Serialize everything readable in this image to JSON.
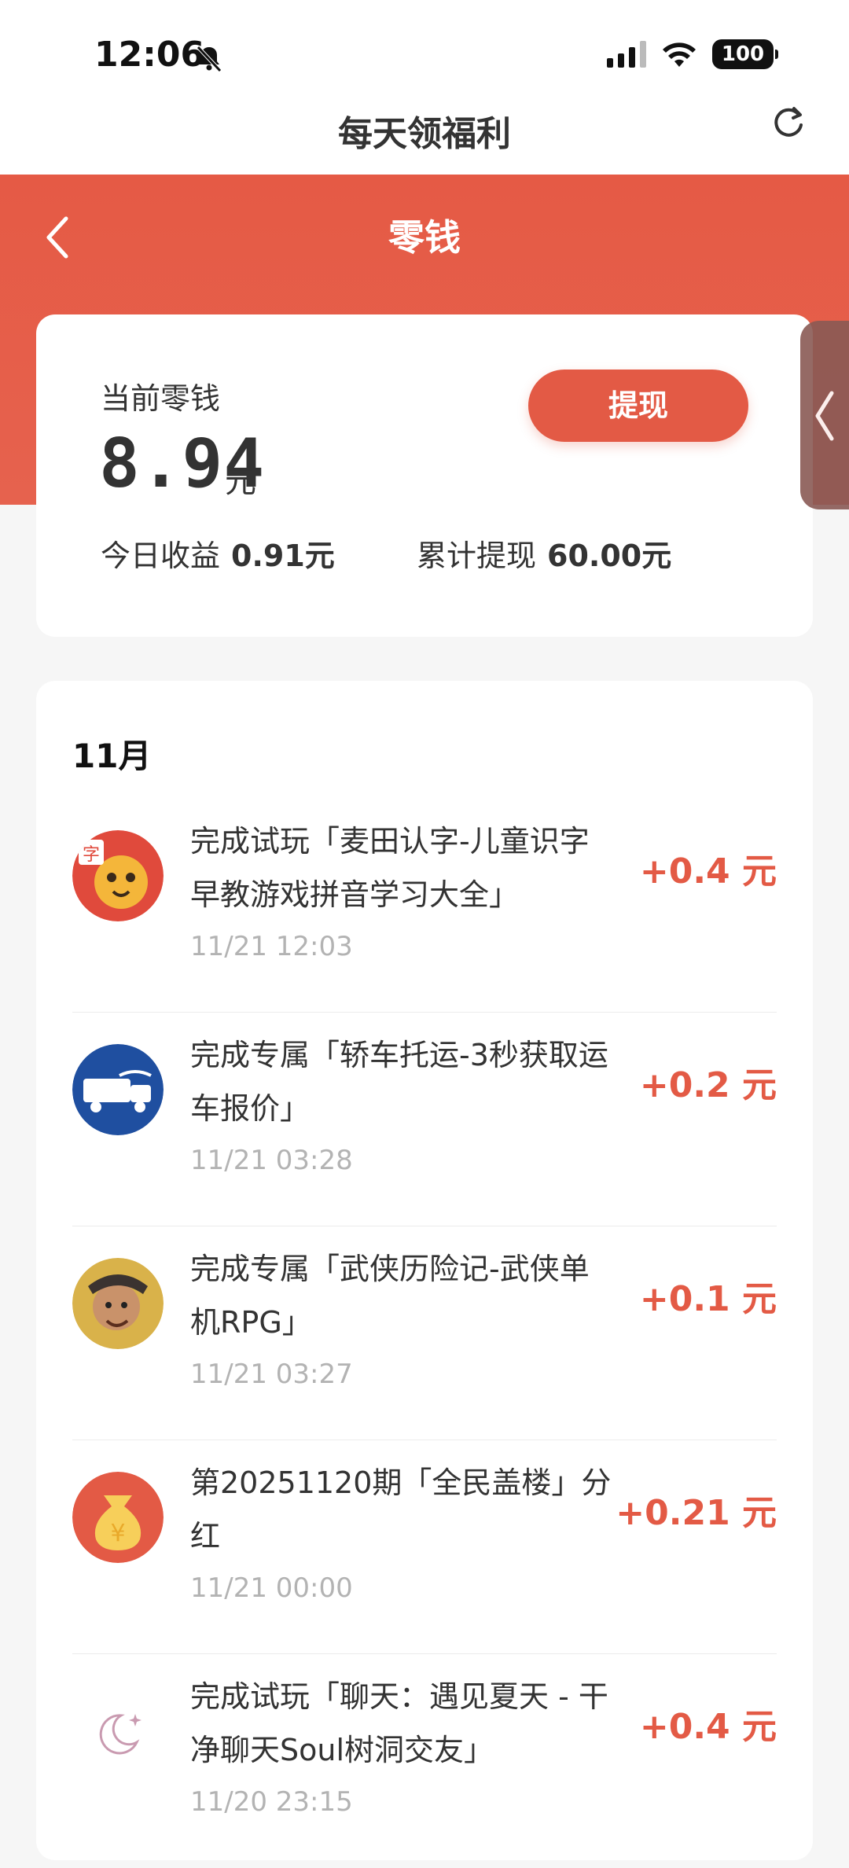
{
  "status_bar": {
    "time": "12:06",
    "battery": "100"
  },
  "app_bar": {
    "title": "每天领福利"
  },
  "header": {
    "title": "零钱"
  },
  "balance": {
    "label": "当前零钱",
    "amount": "8.94",
    "unit": "元",
    "withdraw_label": "提现",
    "today_label": "今日收益",
    "today_value": "0.91元",
    "total_label": "累计提现",
    "total_value": "60.00元"
  },
  "records": {
    "month": "11月",
    "items": [
      {
        "title": "完成试玩「麦田认字-儿童识字早教游戏拼音学习大全」",
        "time": "11/21 12:03",
        "amount": "+0.4 元",
        "icon": "app-icon-maitian"
      },
      {
        "title": "完成专属「轿车托运-3秒获取运车报价」",
        "time": "11/21 03:28",
        "amount": "+0.2 元",
        "icon": "app-icon-car-transport"
      },
      {
        "title": "完成专属「武侠历险记-武侠单机RPG」",
        "time": "11/21 03:27",
        "amount": "+0.1 元",
        "icon": "app-icon-wuxia"
      },
      {
        "title": "第20251120期「全民盖楼」分红",
        "time": "11/21 00:00",
        "amount": "+0.21 元",
        "icon": "money-bag-icon"
      },
      {
        "title": "完成试玩「聊天：遇见夏天 - 干净聊天Soul树洞交友」",
        "time": "11/20 23:15",
        "amount": "+0.4 元",
        "icon": "moon-icon"
      }
    ]
  },
  "colors": {
    "accent": "#e35a45",
    "header_bg": "#e55a45",
    "muted_text": "#b3b3b3"
  }
}
